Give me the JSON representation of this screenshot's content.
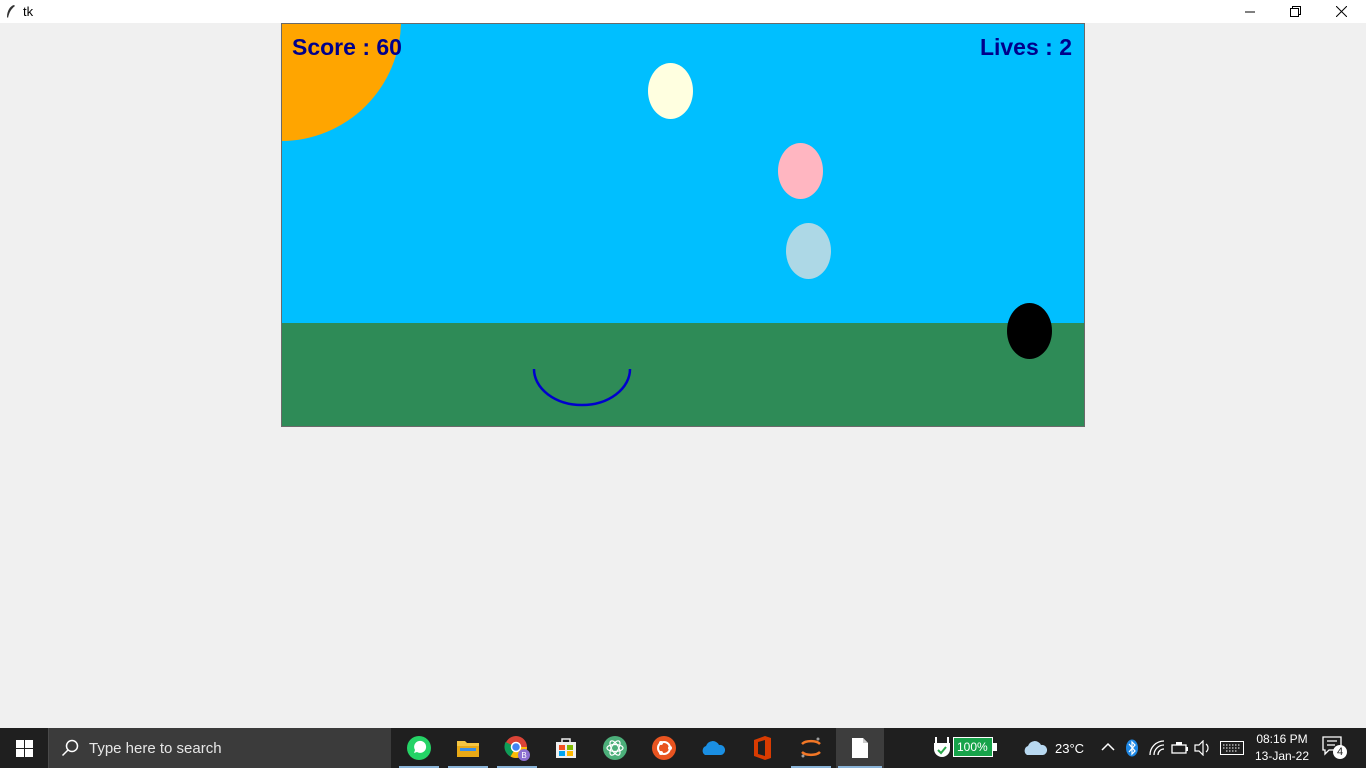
{
  "window": {
    "title": "tk"
  },
  "game": {
    "score_text": "Score : 60",
    "lives_text": "Lives : 2",
    "colors": {
      "sky": "#00bfff",
      "ground": "#2e8b57",
      "sun": "#ffa500",
      "hud_text": "#00008b",
      "catcher": "#0000cd",
      "balls": [
        "#ffffe0",
        "#ffb6c1",
        "#add8e6",
        "#000000"
      ]
    }
  },
  "taskbar": {
    "search_placeholder": "Type here to search",
    "apps": [
      "whatsapp-icon",
      "file-explorer-icon",
      "chrome-icon",
      "store-icon",
      "atom-icon",
      "ubuntu-icon",
      "onedrive-icon",
      "office-icon",
      "jupyter-icon",
      "notepad-icon"
    ],
    "battery_text": "100%",
    "temperature": "23°C",
    "time": "08:16 PM",
    "date": "13-Jan-22",
    "chrome_badge": "B",
    "notification_count": "4"
  }
}
